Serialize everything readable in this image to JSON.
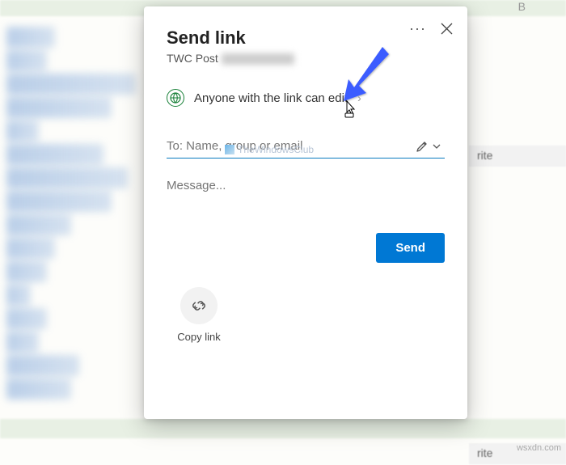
{
  "background": {
    "column_label": "B",
    "right_label": "rite",
    "watermark": "wsxdn.com"
  },
  "dialog": {
    "title": "Send link",
    "subtitle": "TWC Post",
    "permission": {
      "text": "Anyone with the link can edit"
    },
    "logo_text": "TheWindowsClub",
    "to_placeholder": "To: Name, group or email",
    "message_placeholder": "Message...",
    "send_label": "Send",
    "copy_label": "Copy link"
  }
}
